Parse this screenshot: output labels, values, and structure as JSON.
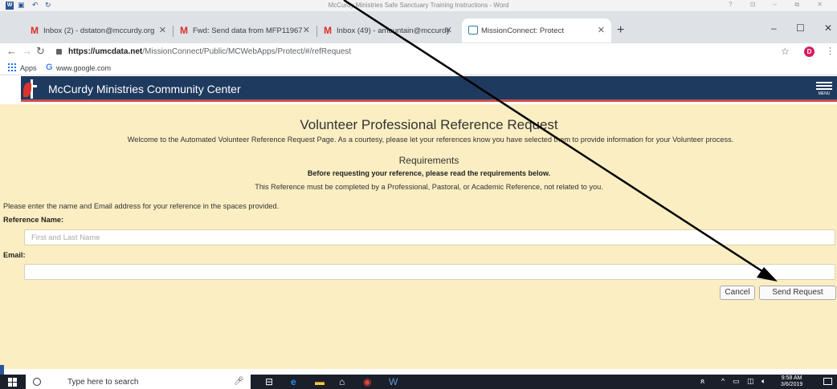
{
  "word": {
    "title": "McCurdy Ministries Safe Sanctuary Training Instructions - Word",
    "controls": "? ⊡ – ⧉ ✕"
  },
  "tabs": [
    {
      "label": "Inbox (2) - dstaton@mccurdy.org",
      "icon": "gmail-icon"
    },
    {
      "label": "Fwd: Send data from MFP11967",
      "icon": "gmail-icon"
    },
    {
      "label": "Inbox (49) - amountain@mccurdy",
      "icon": "gmail-icon"
    },
    {
      "label": "MissionConnect: Protect",
      "icon": "missionconnect-icon",
      "active": true
    }
  ],
  "browser": {
    "url_domain": "https://umcdata.net",
    "url_path": "/MissionConnect/Public/MCWebApps/Protect/#/refRequest",
    "avatar_letter": "D",
    "bookmarks": {
      "apps": "Apps",
      "google": "www.google.com"
    }
  },
  "site": {
    "org_name": "McCurdy Ministries Community Center",
    "menu_label": "MENU"
  },
  "form": {
    "heading": "Volunteer Professional Reference Request",
    "welcome": "Welcome to the Automated Volunteer Reference Request Page. As a courtesy, please let your references know you have selected them to provide information for your Volunteer process.",
    "requirements_heading": "Requirements",
    "requirements_bold": "Before requesting your reference, please read the requirements below.",
    "requirements_note": "This Reference must be completed by a Professional, Pastoral, or Academic Reference, not related to you.",
    "instructions": "Please enter the name and Email address for your reference in the spaces provided.",
    "name_label": "Reference Name:",
    "name_placeholder": "First and Last Name",
    "name_value": "",
    "email_label": "Email:",
    "email_value": "",
    "cancel_label": "Cancel",
    "send_label": "Send Request"
  },
  "taskbar": {
    "search_placeholder": "Type here to search",
    "time": "9:58 AM",
    "date": "3/6/2019"
  },
  "colors": {
    "header_bg": "#1f3a5f",
    "header_border": "#c9514b",
    "content_bg": "#fbeec2"
  }
}
